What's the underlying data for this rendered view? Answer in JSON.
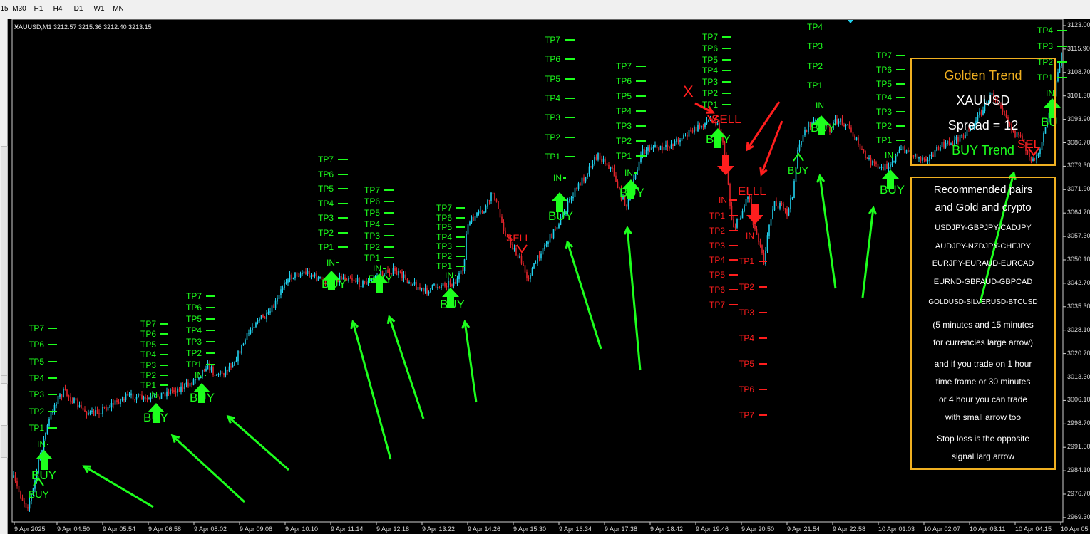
{
  "toolbar": {
    "timeframes": [
      "15",
      "M30",
      "H1",
      "H4",
      "D1",
      "W1",
      "MN"
    ]
  },
  "chart": {
    "symbol_info": "XAUUSD,M1  3212.57 3215.36 3212.40 3213.15",
    "price_labels": [
      "3123.00",
      "3115.90",
      "3108.70",
      "3101.30",
      "3093.90",
      "3086.70",
      "3079.30",
      "3071.90",
      "3064.70",
      "3057.30",
      "3050.10",
      "3042.70",
      "3035.30",
      "3028.10",
      "3020.70",
      "3013.30",
      "3006.10",
      "2998.70",
      "2991.50",
      "2984.10",
      "2976.70",
      "2969.30"
    ],
    "time_labels": [
      "9 Apr 2025",
      "9 Apr 04:50",
      "9 Apr 05:54",
      "9 Apr 06:58",
      "9 Apr 08:02",
      "9 Apr 09:06",
      "9 Apr 10:10",
      "9 Apr 11:14",
      "9 Apr 12:18",
      "9 Apr 13:22",
      "9 Apr 14:26",
      "9 Apr 15:30",
      "9 Apr 16:34",
      "9 Apr 17:38",
      "9 Apr 18:42",
      "9 Apr 19:46",
      "9 Apr 20:50",
      "9 Apr 21:54",
      "9 Apr 22:58",
      "10 Apr 01:03",
      "10 Apr 02:07",
      "10 Apr 03:11",
      "10 Apr 04:15",
      "10 Apr 05"
    ],
    "colors": {
      "background": "#000000",
      "buy": "#1dff1d",
      "sell": "#ff1e1e",
      "bull_candle": "#22d3f0",
      "bear_candle": "#e0242a",
      "panel_border": "#f0b021",
      "panel_title": "#f0b021"
    }
  },
  "labels": {
    "buy": "BUY",
    "bu": "BU",
    "sell": "SELL",
    "sel": "SEL",
    "elll": "ELLL",
    "in": "IN",
    "x_mark": "X",
    "tp1": "TP1",
    "tp2": "TP2",
    "tp3": "TP3",
    "tp4": "TP4",
    "tp5": "TP5",
    "tp6": "TP6",
    "tp7": "TP7"
  },
  "info_panel": {
    "title": "Golden Trend",
    "symbol": "XAUUSD",
    "spread": "Spread = 12",
    "trend": "BUY Trend"
  },
  "notes_panel": {
    "heading_1": "Recommended pairs",
    "heading_2": "and Gold and crypto",
    "pairs_1": "USDJPY-GBPJPY-CADJPY",
    "pairs_2": "AUDJPY-NZDJPY-CHFJPY",
    "pairs_3": "EURJPY-EURAUD-EURCAD",
    "pairs_4": "EURND-GBPAUD-GBPCAD",
    "pairs_5": "GOLDUSD-SILVERUSD-BTCUSD",
    "note_1": "(5 minutes and 15 minutes",
    "note_2": "for currencies large arrow)",
    "note_3": "and if you trade on 1 hour",
    "note_4": "time frame or 30 minutes",
    "note_5": "or 4 hour you can trade",
    "note_6": "with small arrow too",
    "note_7": "Stop loss is the opposite",
    "note_8": "signal larg arrow"
  }
}
